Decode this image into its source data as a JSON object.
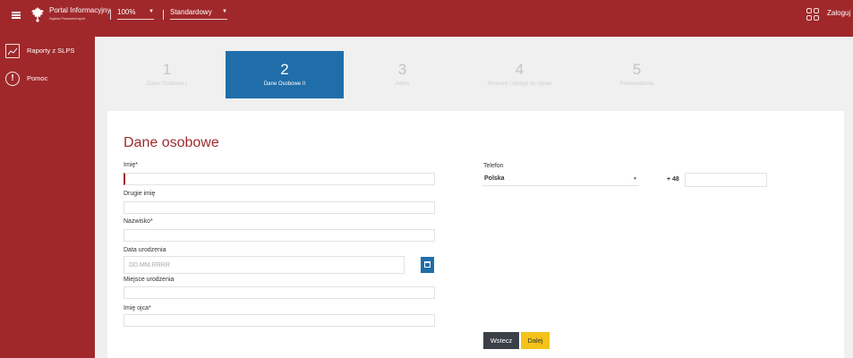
{
  "header": {
    "brand_title": "Portal Informacyjny",
    "brand_subtitle": "Sądów Powszechnych",
    "zoom_value": "100%",
    "theme_value": "Standardowy",
    "login_label": "Zaloguj",
    "colors": {
      "brand_red": "#a0282b",
      "accent_blue": "#1f6ea9",
      "next_yellow": "#f3c318",
      "back_dark": "#3b4048"
    }
  },
  "sidebar": {
    "items": [
      {
        "label": "Raporty z SLPS",
        "icon": "report-icon"
      },
      {
        "label": "Pomoc",
        "icon": "help-icon"
      }
    ]
  },
  "stepper": {
    "active_step": 2,
    "steps": [
      {
        "number": "1",
        "label": "Dane Osobowe I"
      },
      {
        "number": "2",
        "label": "Dane Osobowe II"
      },
      {
        "number": "3",
        "label": "Adres"
      },
      {
        "number": "4",
        "label": "Wniosek i dostęp do spraw"
      },
      {
        "number": "5",
        "label": "Potwierdzenie"
      }
    ]
  },
  "form": {
    "title": "Dane osobowe",
    "first_name": {
      "label": "Imię*",
      "value": ""
    },
    "second_name": {
      "label": "Drugie imię",
      "value": ""
    },
    "last_name": {
      "label": "Nazwisko*",
      "value": ""
    },
    "birth_date": {
      "label": "Data urodzenia",
      "placeholder": "DD.MM.RRRR",
      "value": ""
    },
    "birth_place": {
      "label": "Miejsce urodzenia",
      "value": ""
    },
    "father_name": {
      "label": "Imię ojca*",
      "value": ""
    },
    "phone": {
      "label": "Telefon",
      "country": "Polska",
      "prefix": "+ 48",
      "value": ""
    },
    "back_label": "Wstecz",
    "next_label": "Dalej"
  }
}
